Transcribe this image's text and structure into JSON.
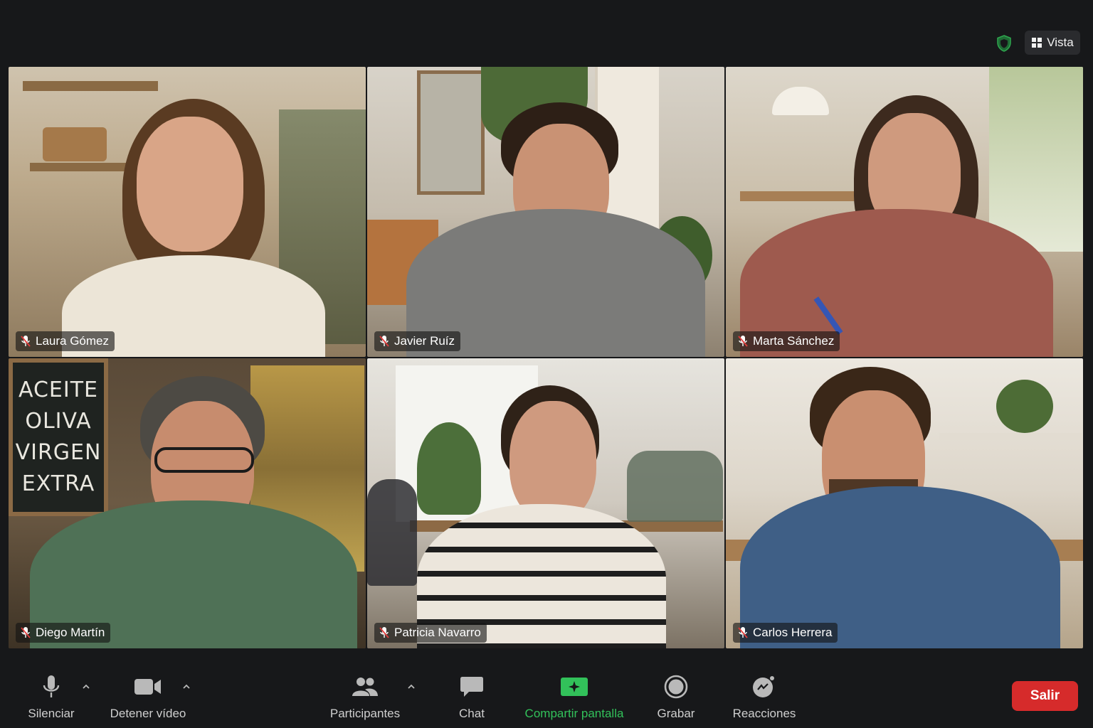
{
  "header": {
    "view_label": "Vista",
    "security_icon": "shield-icon",
    "view_icon": "grid-view-icon"
  },
  "participants": [
    {
      "name": "Laura Gómez",
      "muted": true
    },
    {
      "name": "Javier Ruíz",
      "muted": true
    },
    {
      "name": "Marta Sánchez",
      "muted": true
    },
    {
      "name": "Diego Martín",
      "muted": true
    },
    {
      "name": "Patricia Navarro",
      "muted": true
    },
    {
      "name": "Carlos Herrera",
      "muted": true
    }
  ],
  "background_signage": {
    "chalkboard_text": "ACEITE OLIVA VIRGEN EXTRA"
  },
  "toolbar": {
    "mute_label": "Silenciar",
    "video_label": "Detener vídeo",
    "participants_label": "Participantes",
    "chat_label": "Chat",
    "share_label": "Compartir pantalla",
    "record_label": "Grabar",
    "reactions_label": "Reacciones",
    "leave_label": "Salir"
  },
  "colors": {
    "background": "#17181a",
    "share_accent": "#32c15a",
    "leave_button": "#d62b2b",
    "security_shield": "#2fa84f"
  }
}
